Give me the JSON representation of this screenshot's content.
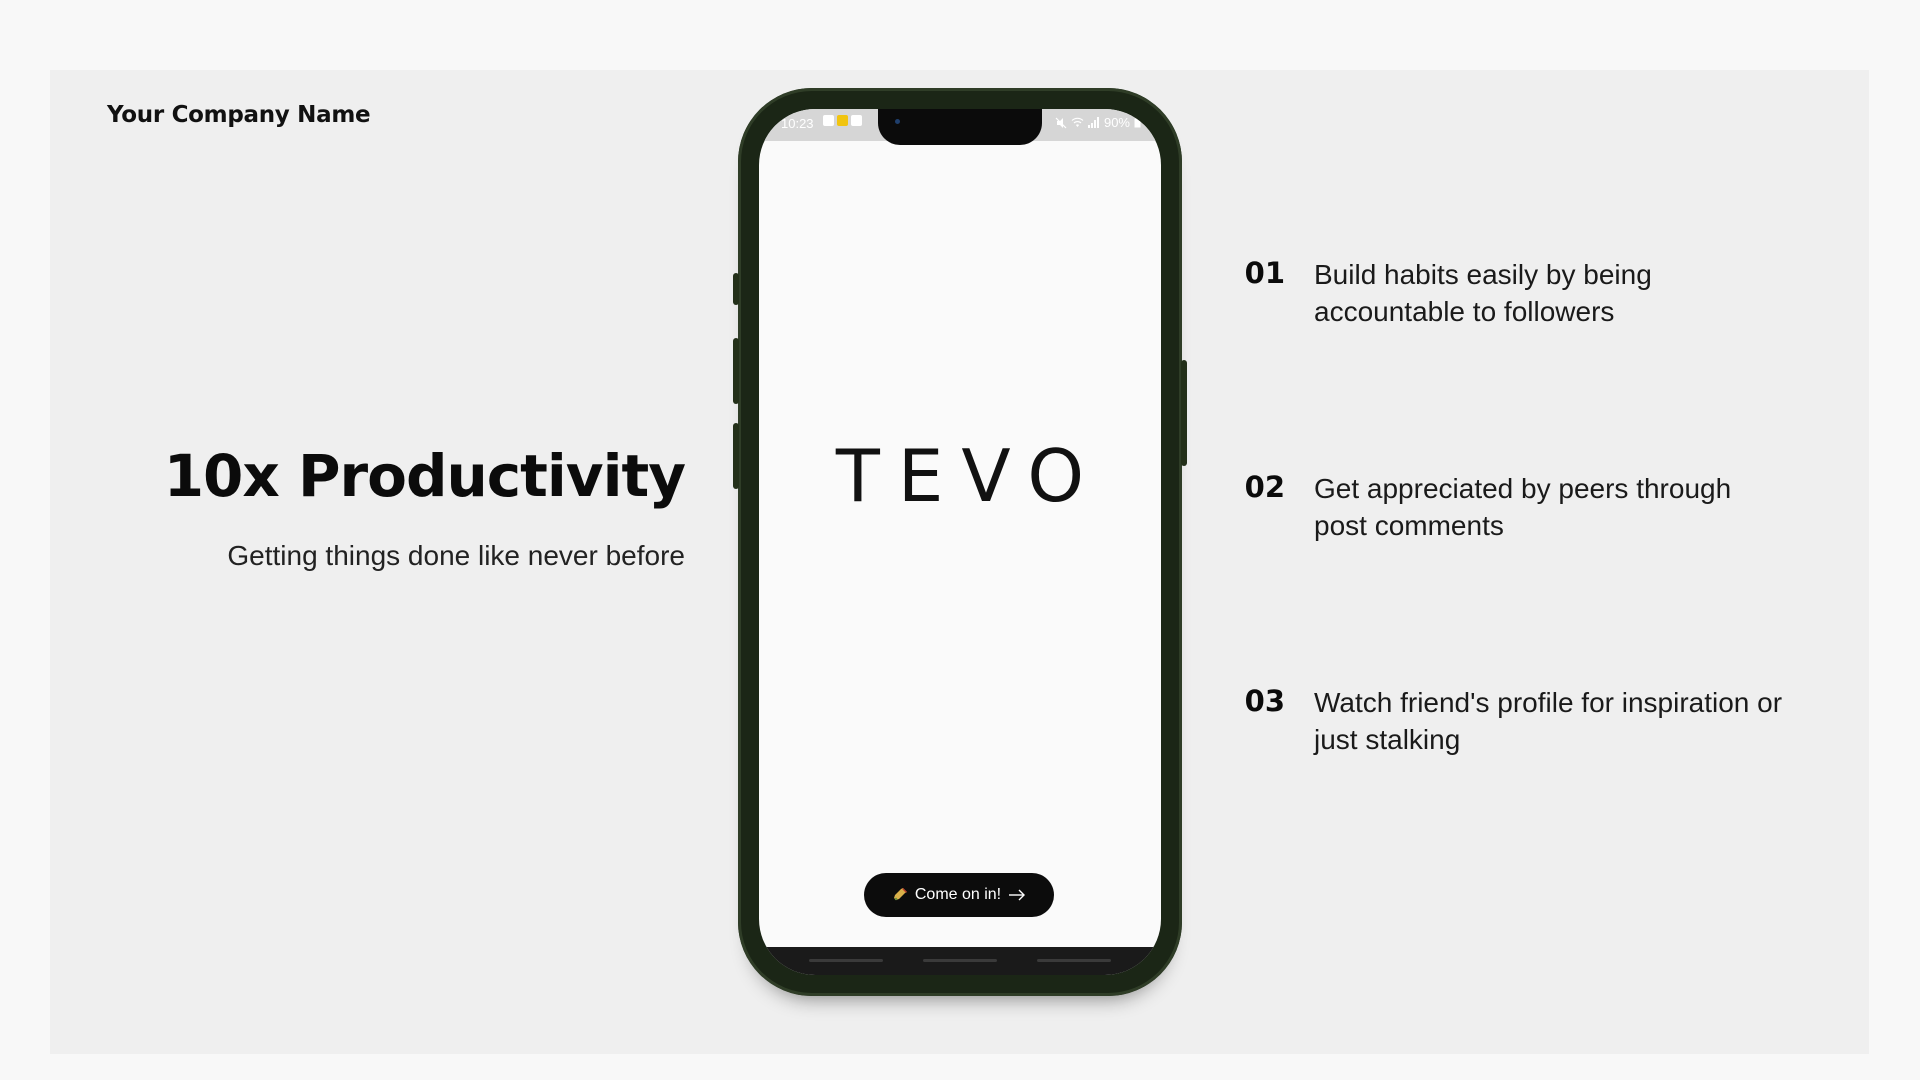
{
  "header": {
    "company_name": "Your Company Name"
  },
  "hero": {
    "headline": "10x Productivity",
    "subheadline": "Getting things done like never before"
  },
  "phone": {
    "status_bar": {
      "time": "10:23",
      "battery": "90%"
    },
    "app_name": "TEVO",
    "cta": {
      "icon": "bottle-icon",
      "label": "Come on in!",
      "arrow": "arrow-right-icon"
    }
  },
  "features": [
    {
      "number": "01",
      "text": "Build habits easily by being accountable to followers"
    },
    {
      "number": "02",
      "text": "Get appreciated by peers through post comments"
    },
    {
      "number": "03",
      "text": "Watch friend's profile for inspiration or just stalking"
    }
  ],
  "colors": {
    "page_background": "#f8f8f8",
    "slide_background": "#efefef",
    "phone_frame": "#1b2616",
    "screen_background": "#fafafa",
    "button_background": "#0c0c0c",
    "text_primary": "#0b0b0b"
  }
}
